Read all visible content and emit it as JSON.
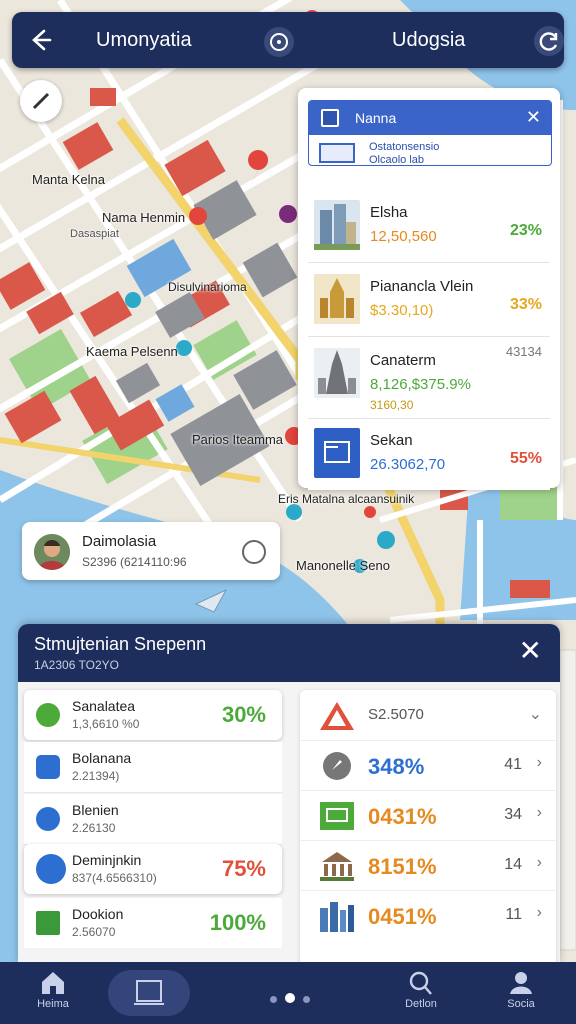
{
  "topbar": {
    "title_left": "Umonyatia",
    "title_right": "Udogsia",
    "back_icon": "arrow-left-icon",
    "refresh_icon": "refresh-icon"
  },
  "map_labels": [
    "Manta Kelna",
    "Nama Henmin",
    "Dasaspiat",
    "Disulvinarioma",
    "Kaema Pelsenn",
    "Parios Iteamma",
    "Eris Matalna alcaansuinik",
    "Manonelle Seno"
  ],
  "right_panel": {
    "title": "Nanna",
    "subtitle": "Ostatonsensio\nOlcaolo lab",
    "rows": [
      {
        "name": "Elsha",
        "value": "12,50,560",
        "pct": "23%"
      },
      {
        "name": "Pianancla Vlein",
        "value": "$3.30,10)",
        "pct": "33%"
      },
      {
        "name": "Canaterm",
        "value": "8,126,$375.9%",
        "value2": "3160,30",
        "pct": "43134"
      },
      {
        "name": "Sekan",
        "value": "26.3062,70",
        "pct": "55%"
      }
    ]
  },
  "person_card": {
    "name": "Daimolasia",
    "sub": "S2396 (6214110:96"
  },
  "sheet": {
    "title": "Stmujtenian Snepenn",
    "subtitle": "1A2306 TO2YO",
    "left_items": [
      {
        "name": "Sanalatea",
        "sub": "1,3,6610 %0",
        "pct": "30%"
      },
      {
        "name": "Bolanana",
        "sub": "2.21394)",
        "pct": ""
      },
      {
        "name": "Blenien",
        "sub": "2.26130",
        "pct": ""
      },
      {
        "name": "Deminjnkin",
        "sub": "837(4.6566310)",
        "pct": "75%"
      },
      {
        "name": "Dookion",
        "sub": "2.56070",
        "pct": "100%"
      }
    ],
    "right_items": [
      {
        "value": "S2.5070",
        "num": ""
      },
      {
        "value": "348%",
        "num": "41"
      },
      {
        "value": "0431%",
        "num": "34"
      },
      {
        "value": "8151%",
        "num": "14"
      },
      {
        "value": "0451%",
        "num": "11"
      }
    ]
  },
  "nav": {
    "items": [
      {
        "label": "Heima",
        "icon": "home-icon"
      },
      {
        "label": "",
        "icon": "terminal-icon"
      },
      {
        "label": "Detlon",
        "icon": "search-icon"
      },
      {
        "label": "Socia",
        "icon": "profile-icon"
      }
    ]
  },
  "colors": {
    "navy": "#1d2d5c",
    "green": "#4caa3a",
    "orange": "#e58a1f",
    "red": "#e0503a",
    "blue": "#2d6fd0"
  }
}
